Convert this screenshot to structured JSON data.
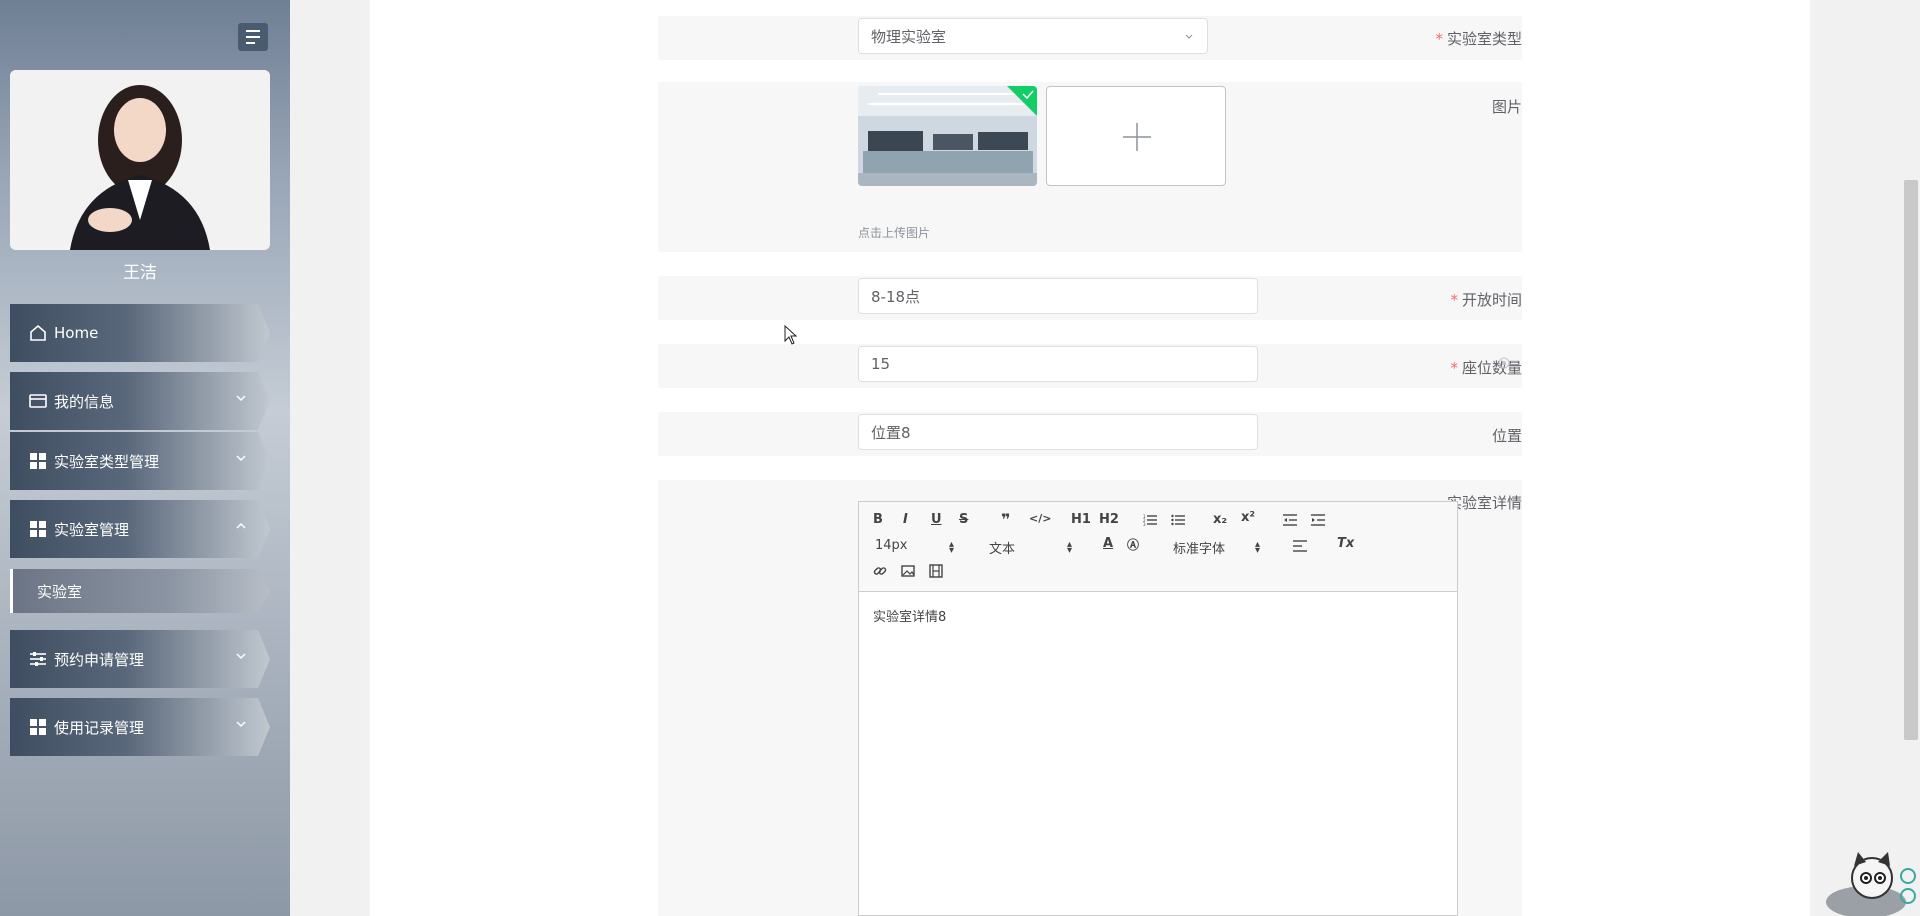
{
  "sidebar": {
    "username": "王洁",
    "menu": [
      {
        "label": "Home",
        "icon": "home-icon"
      },
      {
        "label": "我的信息",
        "icon": "card-icon"
      },
      {
        "label": "实验室类型管理",
        "icon": "grid-icon"
      },
      {
        "label": "实验室管理",
        "icon": "grid-icon",
        "expanded": true
      },
      {
        "label": "预约申请管理",
        "icon": "sliders-icon"
      },
      {
        "label": "使用记录管理",
        "icon": "grid-icon"
      }
    ],
    "submenu_active": "实验室"
  },
  "form": {
    "lab_type": {
      "label": "实验室类型",
      "value": "物理实验室"
    },
    "image": {
      "label": "图片",
      "tip": "点击上传图片"
    },
    "open_time": {
      "label": "开放时间",
      "value": "8-18点"
    },
    "seats": {
      "label": "座位数量",
      "value": "15"
    },
    "location": {
      "label": "位置",
      "value": "位置8"
    },
    "details": {
      "label": "实验室详情",
      "content": "实验室详情8"
    }
  },
  "editor": {
    "font_size": "14px",
    "block_type": "文本",
    "font_family": "标准字体",
    "buttons": {
      "bold": "B",
      "italic": "I",
      "underline": "U",
      "strike": "S",
      "h1": "H1",
      "h2": "H2",
      "sub": "x₂",
      "sup": "x²",
      "clean": "Tx"
    }
  },
  "colors": {
    "required": "#f56c6c",
    "sidebar_dark": "#3f4d60",
    "border": "#dcdfe6"
  }
}
